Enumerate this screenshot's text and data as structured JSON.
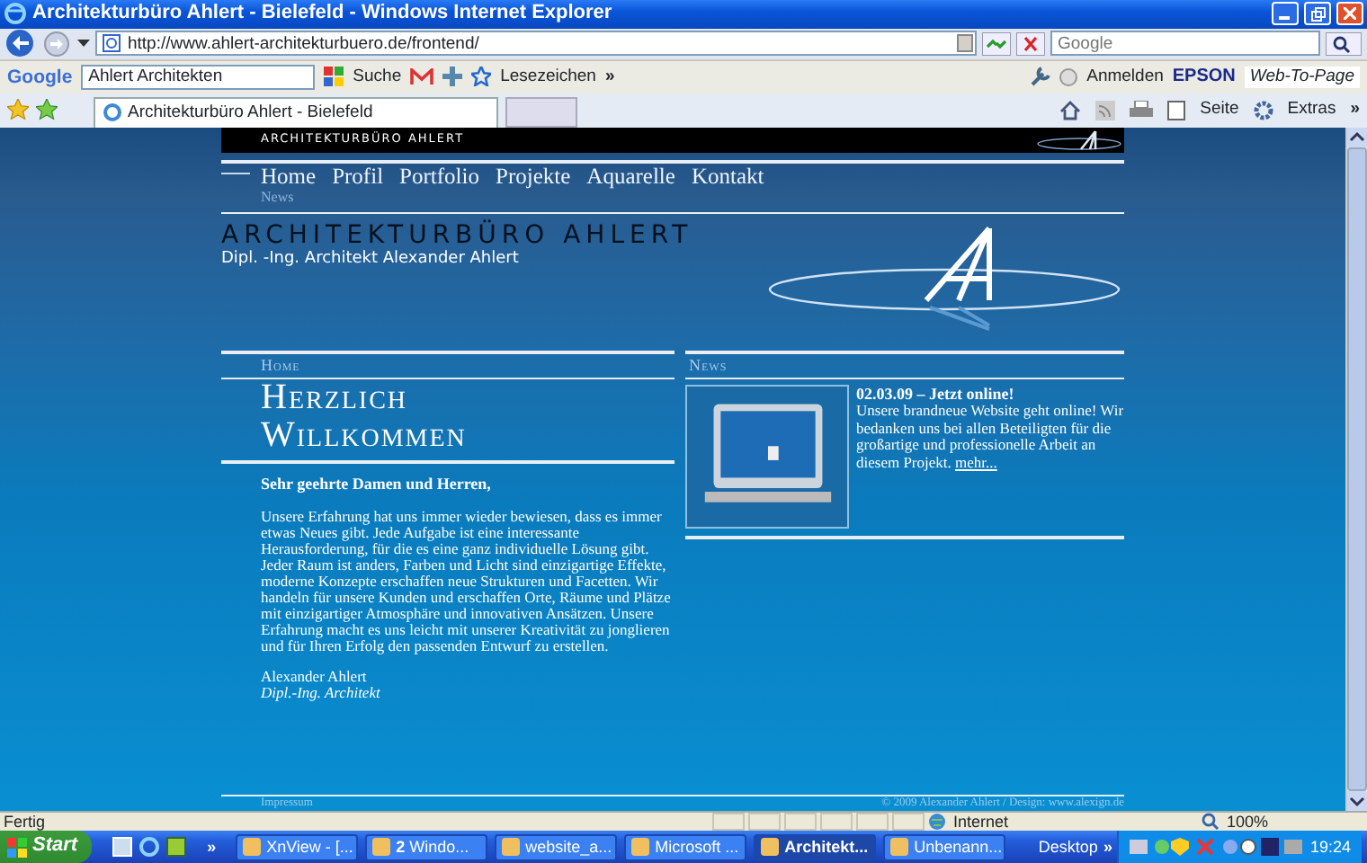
{
  "window": {
    "title": "Architekturbüro Ahlert - Bielefeld - Windows Internet Explorer"
  },
  "address_bar": {
    "url": "http://www.ahlert-architekturbuero.de/frontend/"
  },
  "search_box": {
    "placeholder": "Google"
  },
  "google_toolbar": {
    "logo": "Google",
    "query": "Ahlert Architekten",
    "search": "Suche",
    "bookmarks": "Lesezeichen",
    "more": "»",
    "sign_in": "Anmelden",
    "epson": "EPSON",
    "web_to_page": "Web-To-Page"
  },
  "tabs": [
    {
      "label": "Architekturbüro Ahlert - Bielefeld",
      "selected": true
    }
  ],
  "command_bar": {
    "page": "Seite",
    "tools": "Extras",
    "more": "»"
  },
  "page": {
    "top_bar": "ARCHITEKTURBÜRO AHLERT",
    "nav": [
      "Home",
      "Profil",
      "Portfolio",
      "Projekte",
      "Aquarelle",
      "Kontakt"
    ],
    "sub_nav": "News",
    "banner": {
      "title": "ARCHITEKTURBÜRO AHLERT",
      "subtitle": "Dipl. -Ing. Architekt Alexander Ahlert"
    },
    "main": {
      "section": "Home",
      "heading": "Herzlich Willkommen",
      "greeting": "Sehr geehrte Damen und Herren,",
      "body": "Unsere Erfahrung hat uns immer wieder bewiesen, dass es immer etwas Neues gibt. Jede Aufgabe ist eine interessante Herausforderung, für die es eine ganz individuelle Lösung gibt. Jeder Raum ist anders, Farben und Licht sind einzigartige Effekte, moderne Konzepte erschaffen neue Strukturen und Facetten. Wir handeln für unsere Kunden und erschaffen Orte, Räume und Plätze mit einzigartiger Atmosphäre und innovativen Ansätzen. Unsere Erfahrung macht es uns leicht mit unserer Kreativität zu jonglieren und für Ihren Erfolg den passenden Entwurf zu erstellen.",
      "signature": "Alexander Ahlert",
      "role": "Dipl.-Ing. Architekt"
    },
    "news": {
      "section": "News",
      "items": [
        {
          "title": "02.03.09 – Jetzt online!",
          "text": "Unsere brandneue Website geht online! Wir bedanken uns bei allen Beteiligten für die großartige und professionelle Arbeit an diesem Projekt.",
          "link": "mehr..."
        }
      ]
    },
    "footer": {
      "left": "Impressum",
      "right": "© 2009 Alexander Ahlert / Design: www.alexign.de"
    }
  },
  "status_bar": {
    "text": "Fertig",
    "zone": "Internet",
    "zoom": "100%"
  },
  "taskbar": {
    "start": "Start",
    "more": "»",
    "items": [
      {
        "label": "XnView - [...",
        "selected": false
      },
      {
        "label": "**2** Windo...",
        "selected": false
      },
      {
        "label": "website_a...",
        "selected": false
      },
      {
        "label": "Microsoft ...",
        "selected": false
      },
      {
        "label": "Architekt...",
        "selected": true
      },
      {
        "label": "Unbenann...",
        "selected": false
      }
    ],
    "desktop": "Desktop",
    "tray_more": "»",
    "clock": "19:24"
  }
}
